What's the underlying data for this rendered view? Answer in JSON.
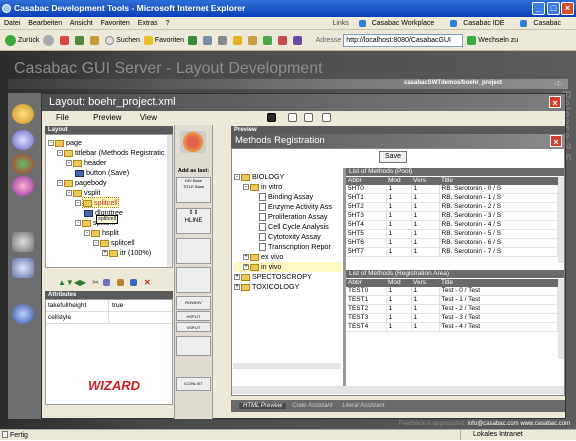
{
  "window": {
    "title": "Casabac Development Tools - Microsoft Internet Explorer"
  },
  "menubar": [
    "Datei",
    "Bearbeiten",
    "Ansicht",
    "Favoriten",
    "Extras",
    "?"
  ],
  "links_bar": {
    "label": "Links",
    "items": [
      "Casabac Workplace",
      "Casabac IDE",
      "Casabac Knowledge Forum"
    ]
  },
  "toolbar": {
    "back": "Zurück",
    "search": "Suchen",
    "favorites": "Favoriten",
    "address_label": "Adresse",
    "address": "http://localhost:8080/CasabacGUI",
    "go": "Wechseln zu"
  },
  "app": {
    "title": "Casabac GUI Server - Layout Development",
    "path": "casabacSWTdemos/boehr_project",
    "release": "Release 3.5"
  },
  "layout": {
    "header": "Layout: boehr_project.xml",
    "menu": [
      "File",
      "Preview",
      "View"
    ],
    "section_layout": "Layout",
    "tree": [
      "page",
      "titlebar (Methods Registratic",
      "header",
      "button (Save)",
      "pagebody",
      "vsplit",
      "splitcell",
      "dlgnttree",
      "splitc...",
      "hsplit",
      "splitcell",
      "itr (100%)"
    ],
    "tooltip": "splitcell",
    "section_attributes": "Attributes",
    "attributes": [
      {
        "name": "takefullheight",
        "value": "true"
      },
      {
        "name": "cellstyle",
        "value": ""
      }
    ],
    "wizard": "WIZARD",
    "add_as_last": "Add as last:",
    "palette": [
      "DIV Base\nTITLE Base",
      "↕↕\nHLINE",
      "ROWDIV",
      "HSPLIT",
      "VSPLIT",
      "ICONLIST"
    ]
  },
  "preview": {
    "section": "Preview",
    "title": "Methods Registration",
    "save": "Save",
    "bio_tree": [
      "BIOLOGY",
      "in vitro",
      "Binding Assay",
      "Enzyme Activity Ass",
      "Proliferation Assay",
      "Cell Cycle Analysis",
      "Cytotoxity Assay",
      "Transcription Repor",
      "ex vivo",
      "in vivo",
      "SPECTOSCROPY",
      "TOXICOLOGY"
    ],
    "pool_title": "List of Methods (Pool)",
    "reg_title": "List of Methods (Registration Area)",
    "columns": [
      "Abbr",
      "Mod",
      "Vers",
      "Title"
    ],
    "pool_rows": [
      [
        "5HT0",
        "1",
        "1",
        "RB. Serotonin - 0 / S"
      ],
      [
        "5HT1",
        "1",
        "1",
        "RB. Serotonin - 1 / S"
      ],
      [
        "5HT2",
        "1",
        "1",
        "RB. Serotonin - 2 / S"
      ],
      [
        "5HT3",
        "1",
        "1",
        "RB. Serotonin - 3 / S"
      ],
      [
        "5HT4",
        "1",
        "1",
        "RB. Serotonin - 4 / S"
      ],
      [
        "5HT5",
        "1",
        "1",
        "RB. Serotonin - 5 / S"
      ],
      [
        "5HT6",
        "1",
        "1",
        "RB. Serotonin - 6 / S"
      ],
      [
        "5HT7",
        "1",
        "1",
        "RB. Serotonin - 7 / S"
      ]
    ],
    "reg_rows": [
      [
        "TEST0",
        "1",
        "1",
        "Test - 0 / Test"
      ],
      [
        "TEST1",
        "1",
        "1",
        "Test - 1 / Test"
      ],
      [
        "TEST2",
        "1",
        "1",
        "Test - 2 / Test"
      ],
      [
        "TEST3",
        "1",
        "1",
        "Test - 3 / Test"
      ],
      [
        "TEST4",
        "1",
        "1",
        "Test - 4 / Test"
      ]
    ],
    "tabs": [
      "HTML Preview",
      "Code Assistant",
      "Literal Assistant"
    ]
  },
  "footer": {
    "text": "Feedback is appreciated:",
    "email": "info@casabac.com",
    "site": "www.casabac.com"
  },
  "statusbar": {
    "left": "Fertig",
    "right": "Lokales Intranet"
  }
}
